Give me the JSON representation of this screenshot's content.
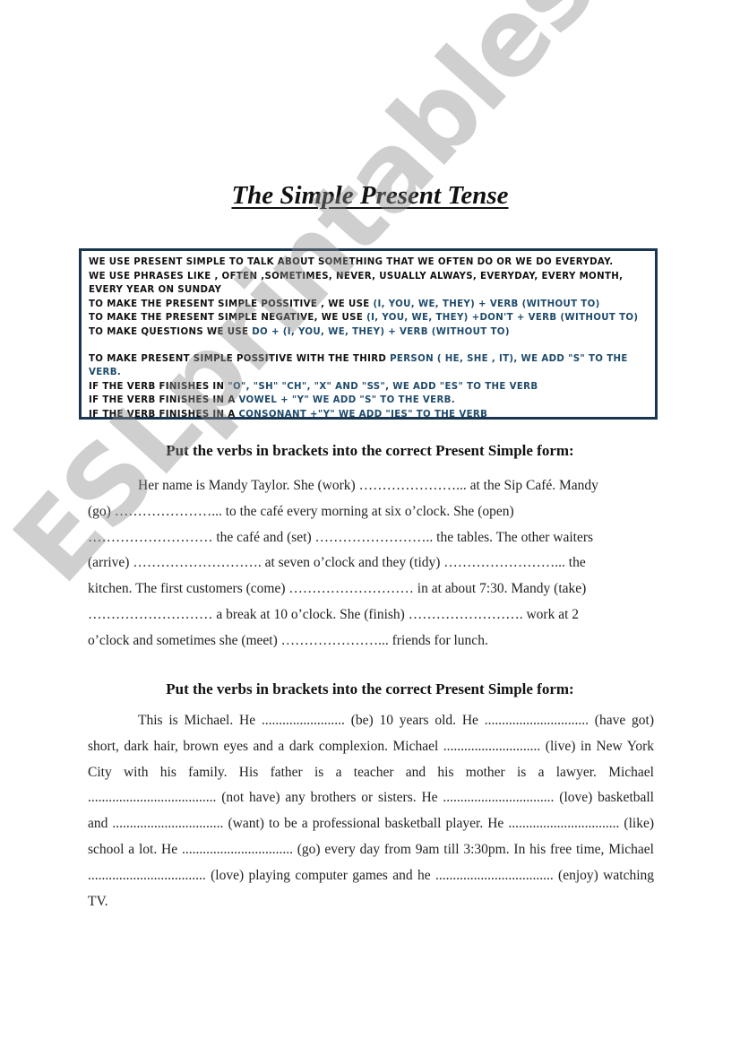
{
  "document": {
    "title": "The Simple Present Tense",
    "watermark": "ESLprintables.com"
  },
  "rules_box": {
    "border_color": "#1a3550",
    "highlight_color": "#1e4a6b",
    "lines": [
      {
        "black": "WE USE PRESENT SIMPLE TO TALK ABOUT SOMETHING THAT WE OFTEN DO OR WE DO EVERYDAY.",
        "blue": ""
      },
      {
        "black": "WE USE PHRASES LIKE , OFTEN ,SOMETIMES, NEVER, USUALLY ALWAYS, EVERYDAY, EVERY MONTH,",
        "blue": ""
      },
      {
        "black": "EVERY YEAR ON SUNDAY",
        "blue": ""
      },
      {
        "black": "TO MAKE THE PRESENT SIMPLE POSSITIVE , WE USE ",
        "blue": "(I, YOU, WE, THEY) + VERB (WITHOUT TO)"
      },
      {
        "black": "TO MAKE THE PRESENT SIMPLE NEGATIVE, WE USE ",
        "blue": "(I, YOU, WE, THEY) +DON'T + VERB (WITHOUT TO)"
      },
      {
        "black": "TO MAKE QUESTIONS WE USE ",
        "blue": "DO + (I, YOU, WE, THEY) + VERB (WITHOUT TO)"
      },
      {
        "black": "TO MAKE PRESENT SIMPLE POSSITIVE WITH THE THIRD ",
        "blue": "PERSON ( HE, SHE , IT), WE ADD \"S\" TO THE VERB."
      },
      {
        "black": "IF THE VERB FINISHES IN ",
        "blue": "\"O\", \"SH\" \"CH\", \"X\" AND \"SS\", WE ADD \"ES\" TO THE VERB"
      },
      {
        "black": "IF THE VERB FINISHES IN A ",
        "blue": "VOWEL + \"Y\" WE ADD \"S\" TO THE VERB."
      },
      {
        "black": "IF THE VERB FINISHES IN A ",
        "blue": "CONSONANT +\"Y\" WE ADD \"IES\" TO THE VERB"
      }
    ]
  },
  "exercise_1": {
    "heading": "Put the verbs in brackets into the correct Present Simple form:",
    "lines": [
      "Her name is Mandy Taylor. She (work) …………………... at the Sip Café. Mandy",
      "(go) …………………... to the café every morning at six o’clock. She (open)",
      "……………………… the café and (set) …………………….. the tables. The other waiters",
      "(arrive) ………………………. at seven o’clock and they (tidy) ……………………... the",
      "kitchen. The first customers (come) ……………………… in at about 7:30. Mandy (take)",
      "……………………… a break at 10 o’clock. She (finish) ……………………. work at 2",
      "o’clock and sometimes she (meet) …………………... friends for lunch."
    ]
  },
  "exercise_2": {
    "heading": "Put the verbs in brackets into the correct Present Simple form:",
    "text": "This is Michael. He ........................ (be) 10 years old. He .............................. (have got) short, dark hair, brown eyes and a dark complexion. Michael ............................ (live) in New York City with his family. His father is a teacher and his mother is a lawyer. Michael ..................................... (not have) any brothers or sisters. He ................................ (love) basketball and ................................ (want) to be a professional basketball player. He ................................ (like) school a lot. He ................................ (go) every day from 9am till 3:30pm. In his free time, Michael .................................. (love) playing computer games and he .................................. (enjoy) watching TV."
  }
}
